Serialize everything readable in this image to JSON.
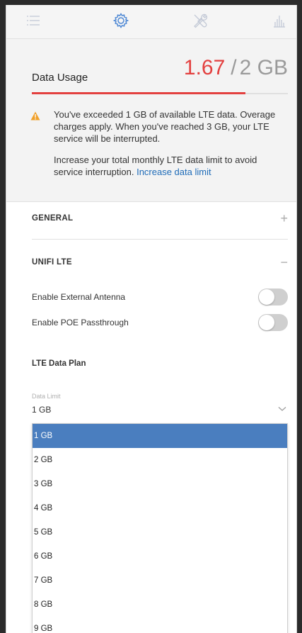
{
  "tabs": [
    {
      "name": "list-icon"
    },
    {
      "name": "gear-icon"
    },
    {
      "name": "tools-icon"
    },
    {
      "name": "stats-icon"
    }
  ],
  "usage": {
    "title": "Data Usage",
    "used": "1.67",
    "limit": "2 GB",
    "separator": "/",
    "fraction": 0.835,
    "accent_color": "#e3403f",
    "warning": "You've exceeded 1 GB of available LTE data. Overage charges apply. When you've reached 3 GB, your LTE service will be interrupted.",
    "advice": "Increase your total monthly LTE data limit to avoid service interruption.",
    "link": "Increase data limit"
  },
  "sections": {
    "general": {
      "label": "GENERAL",
      "toggle": "+"
    },
    "unifi_lte": {
      "label": "UNIFI LTE",
      "toggle": "−"
    }
  },
  "settings": {
    "external_antenna": {
      "label": "Enable External Antenna",
      "on": false
    },
    "poe_passthrough": {
      "label": "Enable POE Passthrough",
      "on": false
    }
  },
  "plan": {
    "title": "LTE Data Plan",
    "field_label": "Data Limit",
    "field_value": "1 GB",
    "options": [
      "1 GB",
      "2 GB",
      "3 GB",
      "4 GB",
      "5 GB",
      "6 GB",
      "7 GB",
      "8 GB",
      "9 GB"
    ],
    "selected_index": 0
  }
}
